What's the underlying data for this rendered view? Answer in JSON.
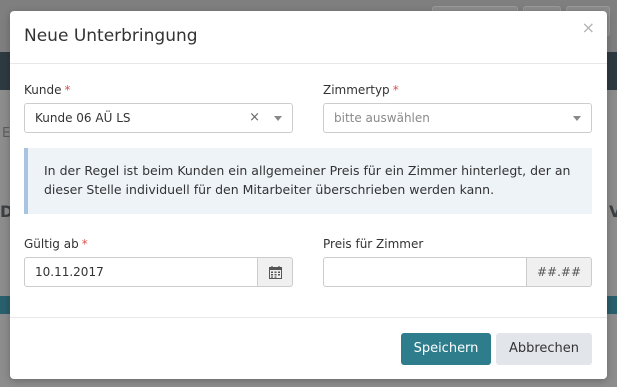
{
  "modal": {
    "title": "Neue Unterbringung",
    "close_glyph": "×"
  },
  "kunde": {
    "label": "Kunde",
    "required_mark": "*",
    "value": "Kunde 06 AÜ LS",
    "clear_glyph": "×"
  },
  "zimmertyp": {
    "label": "Zimmertyp",
    "required_mark": "*",
    "placeholder": "bitte auswählen"
  },
  "info": {
    "text_line1": "In der Regel ist beim Kunden ein allgemeiner Preis für ein Zimmer hinterlegt, der an",
    "text_line2": "dieser Stelle individuell für den Mitarbeiter überschrieben werden kann."
  },
  "gueltig_ab": {
    "label": "Gültig ab",
    "required_mark": "*",
    "value": "10.11.2017"
  },
  "preis": {
    "label": "Preis für Zimmer",
    "value": "",
    "addon": "##.##"
  },
  "footer": {
    "save_label": "Speichern",
    "cancel_label": "Abbrechen"
  },
  "background": {
    "letter_left": "D",
    "letter_right": "V",
    "letter_e": "E"
  },
  "colors": {
    "primary": "#2e7d8c",
    "required": "#d9534f",
    "info_bg": "#eef3f8",
    "info_border": "#a8c4e0"
  }
}
